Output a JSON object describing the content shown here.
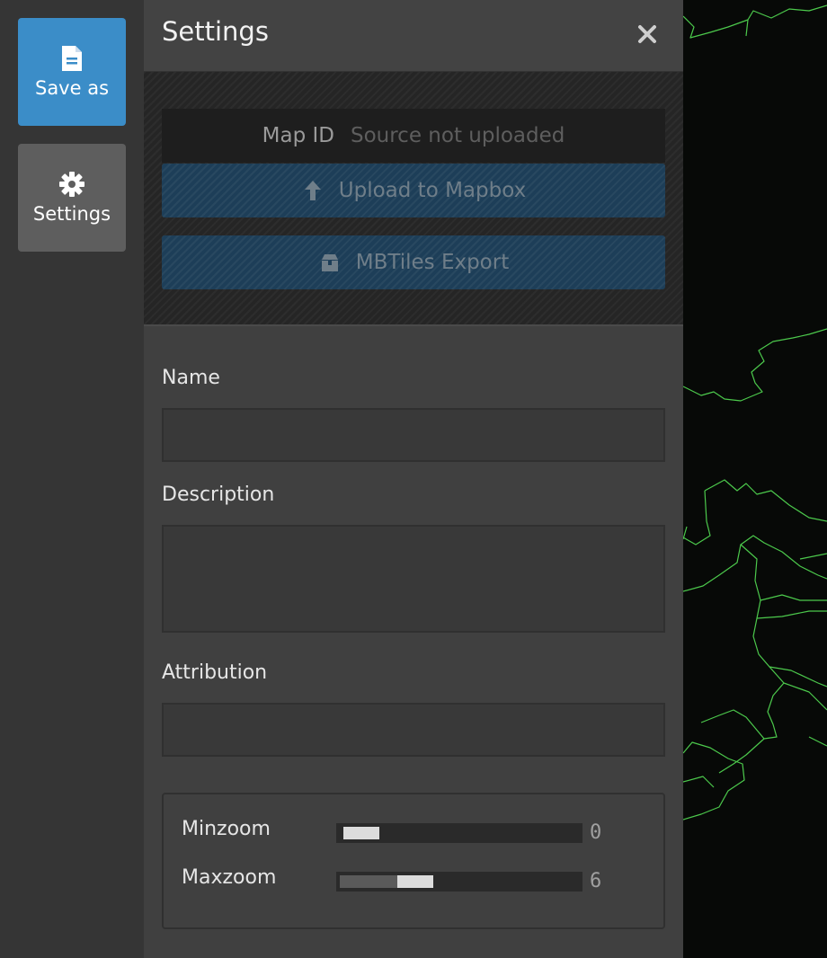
{
  "toolbar": {
    "save_as_label": "Save as",
    "save_as_icon": "document-icon",
    "settings_label": "Settings",
    "settings_icon": "gear-icon"
  },
  "settings_panel": {
    "title": "Settings",
    "close_icon": "close-icon",
    "map_id_label": "Map ID",
    "map_id_value": "Source not uploaded",
    "upload_button_label": "Upload to Mapbox",
    "upload_icon": "arrow-up-icon",
    "export_button_label": "MBTiles Export",
    "export_icon": "package-icon",
    "name_label": "Name",
    "name_value": "",
    "description_label": "Description",
    "description_value": "",
    "attribution_label": "Attribution",
    "attribution_value": "",
    "minzoom_label": "Minzoom",
    "minzoom_value": "0",
    "maxzoom_label": "Maxzoom",
    "maxzoom_value": "6"
  },
  "colors": {
    "accent": "#3b8dc8",
    "map_boundary": "#4cc94c"
  }
}
